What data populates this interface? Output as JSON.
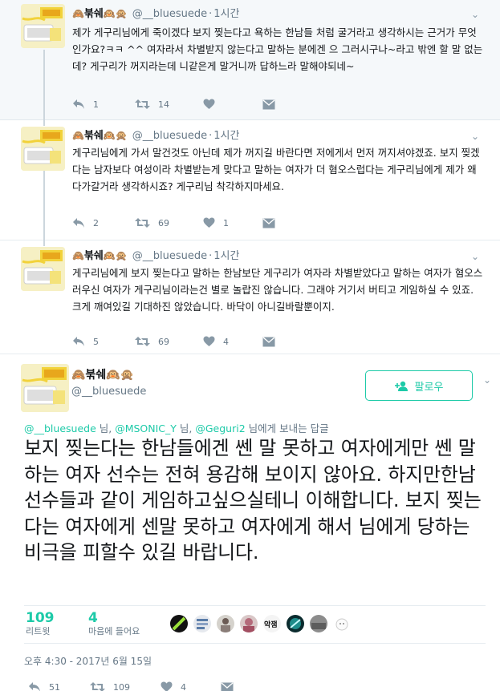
{
  "colors": {
    "accent": "#1dcaa8",
    "muted": "#657786",
    "text": "#14171a",
    "thread_line": "#ccd6dd"
  },
  "thread": [
    {
      "name_emoji_left": "🙈",
      "name": "붂쉐",
      "name_emoji_right": "🙉🙊",
      "handle": "@__bluesuede",
      "time": "1시간",
      "text": "제가 게구리님에게 죽이겠다 보지 찢는다고 욕하는 한남들 처럼 굴거라고 생각하시는 근거가 무엇인가요?ㅋㅋ ^^ 여자라서 차별받지 않는다고 말하는 분에겐 으 그러시구나~라고 밖엔 할 말 없는데? 게구리가 꺼지라는데 니같은게 말거니까 답하느라 말해야되네~",
      "replies": "1",
      "retweets": "14",
      "likes": ""
    },
    {
      "name_emoji_left": "🙈",
      "name": "붂쉐",
      "name_emoji_right": "🙉🙊",
      "handle": "@__bluesuede",
      "time": "1시간",
      "text": "게구리님에게 가서 말건것도 아닌데 제가 꺼지길 바란다면 저에게서 먼저 꺼지셔야겠죠. 보지 찢겠다는 남자보다 여성이라 차별받는게 맞다고 말하는 여자가 더 혐오스럽다는 게구리님에게 제가 왜 다가갈거라 생각하시죠? 게구리님 착각하지마세요.",
      "replies": "2",
      "retweets": "69",
      "likes": "1"
    },
    {
      "name_emoji_left": "🙈",
      "name": "붂쉐",
      "name_emoji_right": "🙉🙊",
      "handle": "@__bluesuede",
      "time": "1시간",
      "text": "게구리님에게 보지 찢는다고 말하는 한남보단 게구리가 여자라 차별받았다고 말하는 여자가 혐오스러우신 여자가 게구리님이라는건 별로 놀랍진 않습니다. 그래야 거기서 버티고 게임하실 수 있죠. 크게 깨여있길 기대하진 않았습니다. 바닥이 아니길바랄뿐이지.",
      "replies": "5",
      "retweets": "69",
      "likes": "4"
    }
  ],
  "main": {
    "name_emoji_left": "🙈",
    "name": "붂쉐",
    "name_emoji_right": "🙉🙊",
    "handle": "@__bluesuede",
    "follow_label": "팔로우",
    "reply_mention_1": "@__bluesuede",
    "reply_sep_1": " 님, ",
    "reply_mention_2": "@MSONIC_Y",
    "reply_sep_2": " 님, ",
    "reply_mention_3": "@Geguri2",
    "reply_suffix": " 님에게 보내는 답글",
    "text": "보지 찢는다는 한남들에겐 쎈 말 못하고 여자에게만 쎈 말 하는 여자 선수는 전혀 용감해 보이지 않아요. 하지만한남선수들과 같이 게임하고싶으실테니 이해합니다. 보지 찢는다는 여자에게 센말 못하고 여자에게 해서 님에게 당하는 비극을 피할수 있길 바랍니다.",
    "retweet_count": "109",
    "retweet_label": "리트윗",
    "like_count": "4",
    "like_label": "마음에 들어요",
    "liker_overlay_text": "악잼",
    "date": "오후 4:30 - 2017년 6월 15일",
    "replies": "51",
    "retweets": "109",
    "likes": "4"
  }
}
